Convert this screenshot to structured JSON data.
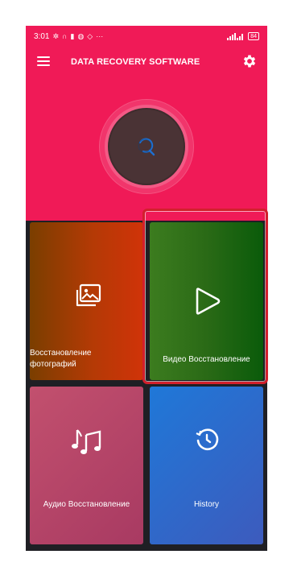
{
  "status_bar": {
    "time": "3:01",
    "battery": "84",
    "more": "···"
  },
  "app_bar": {
    "title": "DATA RECOVERY SOFTWARE",
    "menu_icon": "hamburger-menu-icon",
    "settings_icon": "gear-icon"
  },
  "scan": {
    "icon": "magnifier-spinner-icon"
  },
  "tiles": [
    {
      "label": "Восстановление фотографий",
      "icon": "photos-icon"
    },
    {
      "label": "Видео Восстановление",
      "icon": "play-icon"
    },
    {
      "label": "Аудио Восстановление",
      "icon": "music-notes-icon"
    },
    {
      "label": "History",
      "icon": "history-icon"
    }
  ],
  "colors": {
    "header": "#f01a57",
    "background": "#1f1f24",
    "highlight": "#d21f2c"
  }
}
